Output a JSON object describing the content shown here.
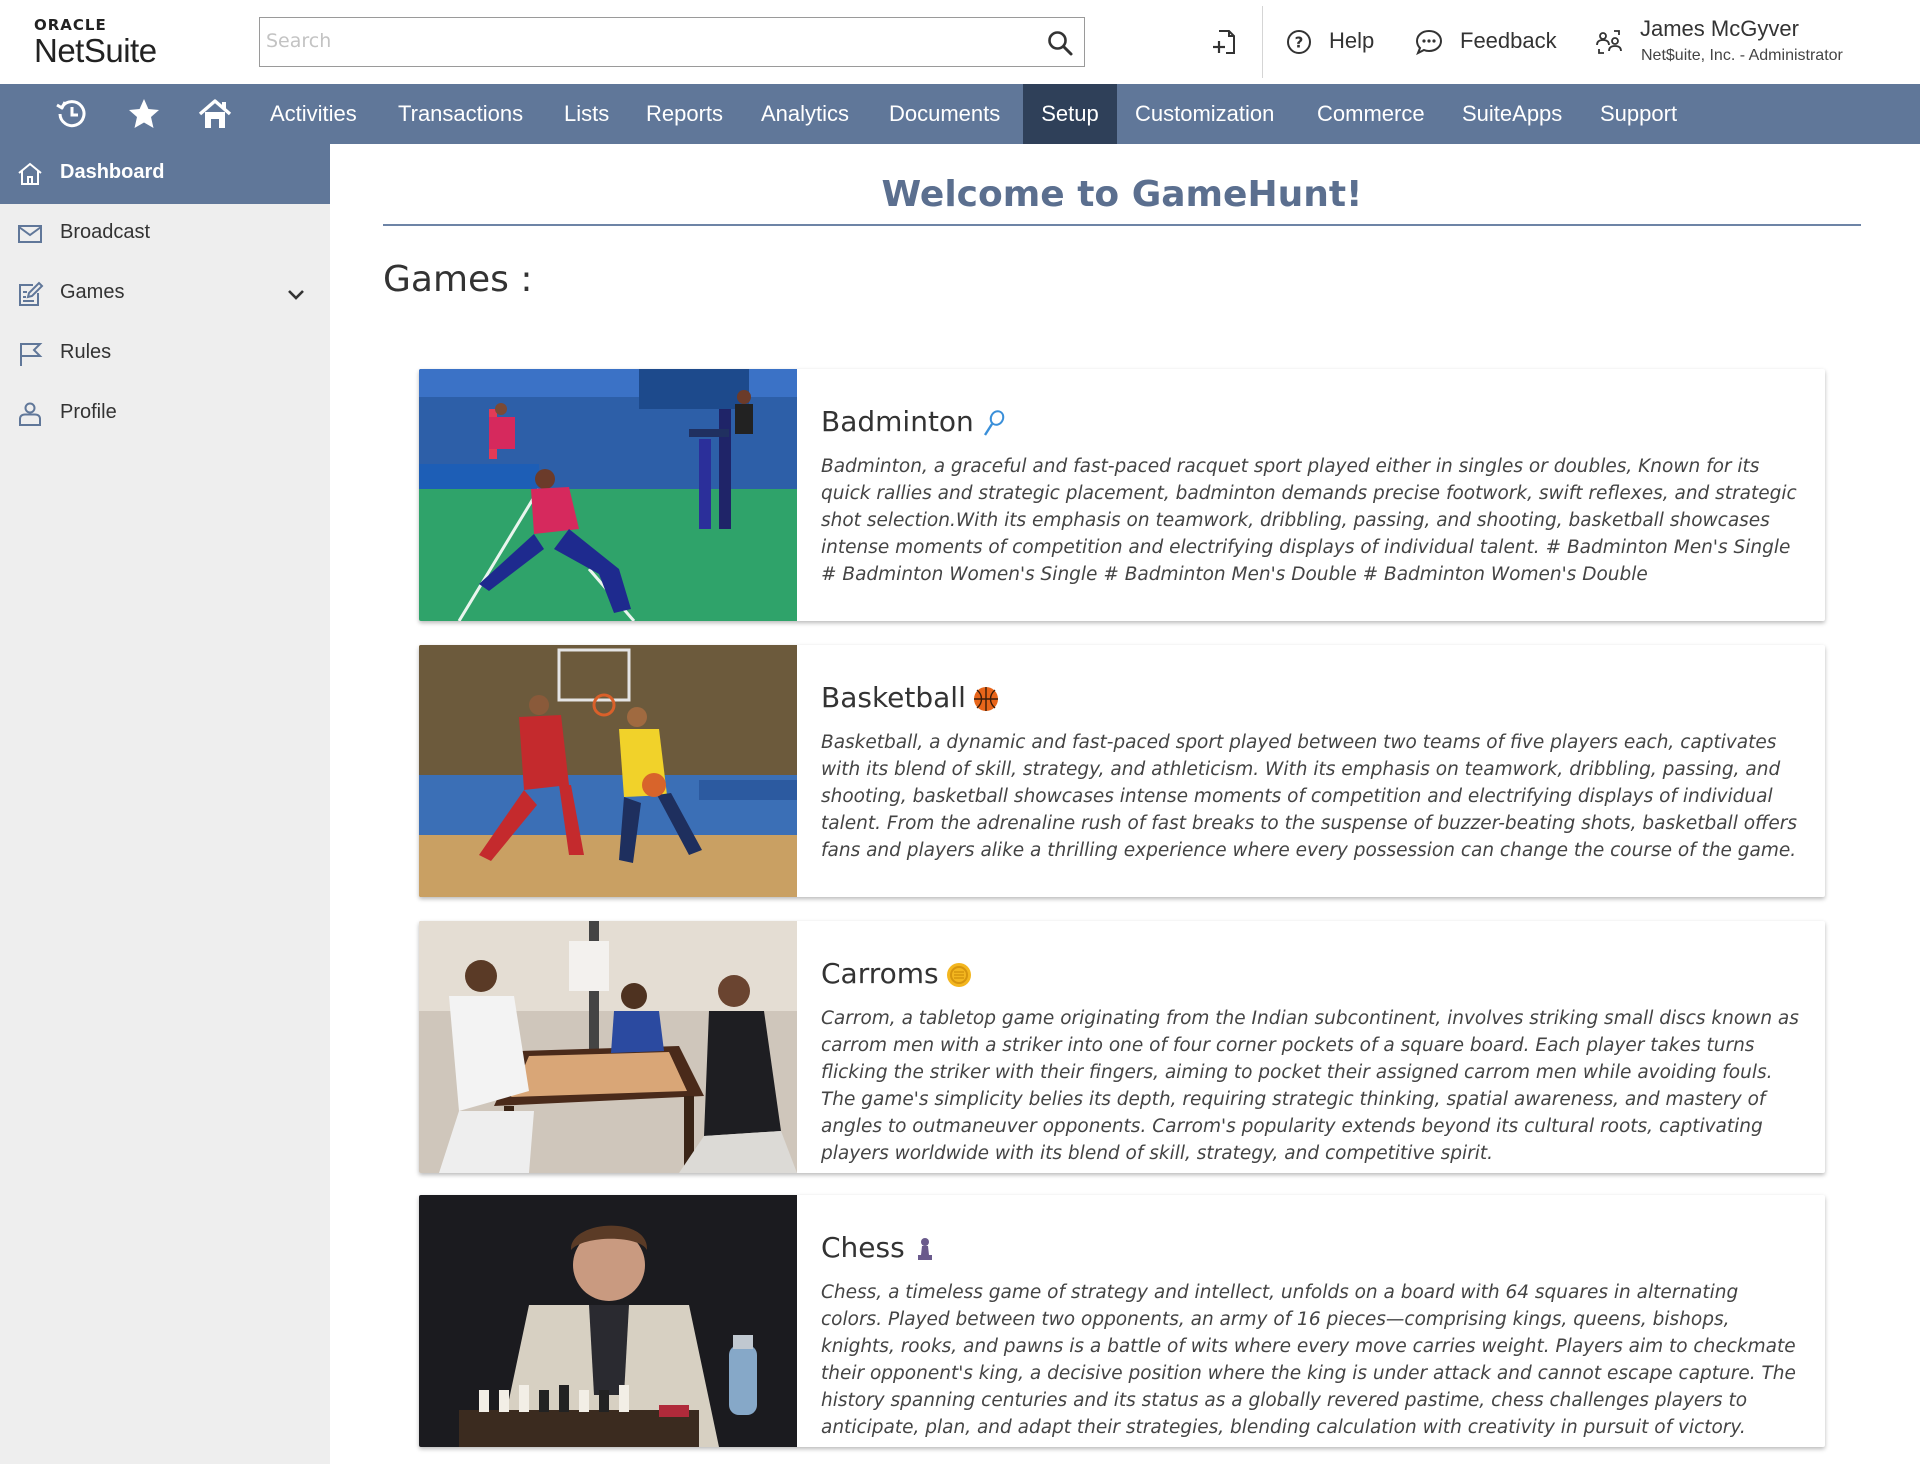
{
  "logo": {
    "oracle": "ORACLE",
    "product": "NetSuite"
  },
  "search": {
    "placeholder": "Search"
  },
  "header": {
    "help_label": "Help",
    "feedback_label": "Feedback",
    "user_name": "James McGyver",
    "user_role": "Net$uite, Inc. - Administrator"
  },
  "nav": {
    "items": [
      "Activities",
      "Transactions",
      "Lists",
      "Reports",
      "Analytics",
      "Documents",
      "Setup",
      "Customization",
      "Commerce",
      "SuiteApps",
      "Support"
    ],
    "active": "Setup"
  },
  "sidebar": {
    "items": [
      {
        "label": "Dashboard",
        "icon": "home-icon"
      },
      {
        "label": "Broadcast",
        "icon": "mail-icon"
      },
      {
        "label": "Games",
        "icon": "edit-icon"
      },
      {
        "label": "Rules",
        "icon": "flag-icon"
      },
      {
        "label": "Profile",
        "icon": "user-icon"
      }
    ],
    "active": "Dashboard"
  },
  "main": {
    "welcome": "Welcome to GameHunt!",
    "games_heading": "Games :",
    "games": [
      {
        "title": "Badminton",
        "emoji": "badminton-racquet-icon",
        "description": "Badminton, a graceful and fast-paced racquet sport played either in singles or doubles, Known for its quick rallies and strategic placement, badminton demands precise footwork, swift reflexes, and strategic shot selection.With its emphasis on teamwork, dribbling, passing, and shooting, basketball showcases intense moments of competition and electrifying displays of individual talent. # Badminton Men's Single # Badminton Women's Single # Badminton Men's Double # Badminton Women's Double"
      },
      {
        "title": "Basketball",
        "emoji": "basketball-icon",
        "description": "Basketball, a dynamic and fast-paced sport played between two teams of five players each, captivates with its blend of skill, strategy, and athleticism. With its emphasis on teamwork, dribbling, passing, and shooting, basketball showcases intense moments of competition and electrifying displays of individual talent. From the adrenaline rush of fast breaks to the suspense of buzzer-beating shots, basketball offers fans and players alike a thrilling experience where every possession can change the course of the game."
      },
      {
        "title": "Carroms",
        "emoji": "carrom-coin-icon",
        "description": "Carrom, a tabletop game originating from the Indian subcontinent, involves striking small discs known as carrom men with a striker into one of four corner pockets of a square board. Each player takes turns flicking the striker with their fingers, aiming to pocket their assigned carrom men while avoiding fouls. The game's simplicity belies its depth, requiring strategic thinking, spatial awareness, and mastery of angles to outmaneuver opponents. Carrom's popularity extends beyond its cultural roots, captivating players worldwide with its blend of skill, strategy, and competitive spirit."
      },
      {
        "title": "Chess",
        "emoji": "chess-pawn-icon",
        "description": "Chess, a timeless game of strategy and intellect, unfolds on a board with 64 squares in alternating colors. Played between two opponents, an army of 16 pieces—comprising kings, queens, bishops, knights, rooks, and pawns is a battle of wits where every move carries weight. Players aim to checkmate their opponent's king, a decisive position where the king is under attack and cannot escape capture. The history spanning centuries and its status as a globally revered pastime, chess challenges players to anticipate, plan, and adapt their strategies, blending calculation with creativity in pursuit of victory."
      }
    ]
  },
  "colors": {
    "nav_bg": "#607799",
    "nav_active": "#2f4059",
    "sidebar_bg": "#eeeeee",
    "welcome_text": "#5b6f8f"
  }
}
